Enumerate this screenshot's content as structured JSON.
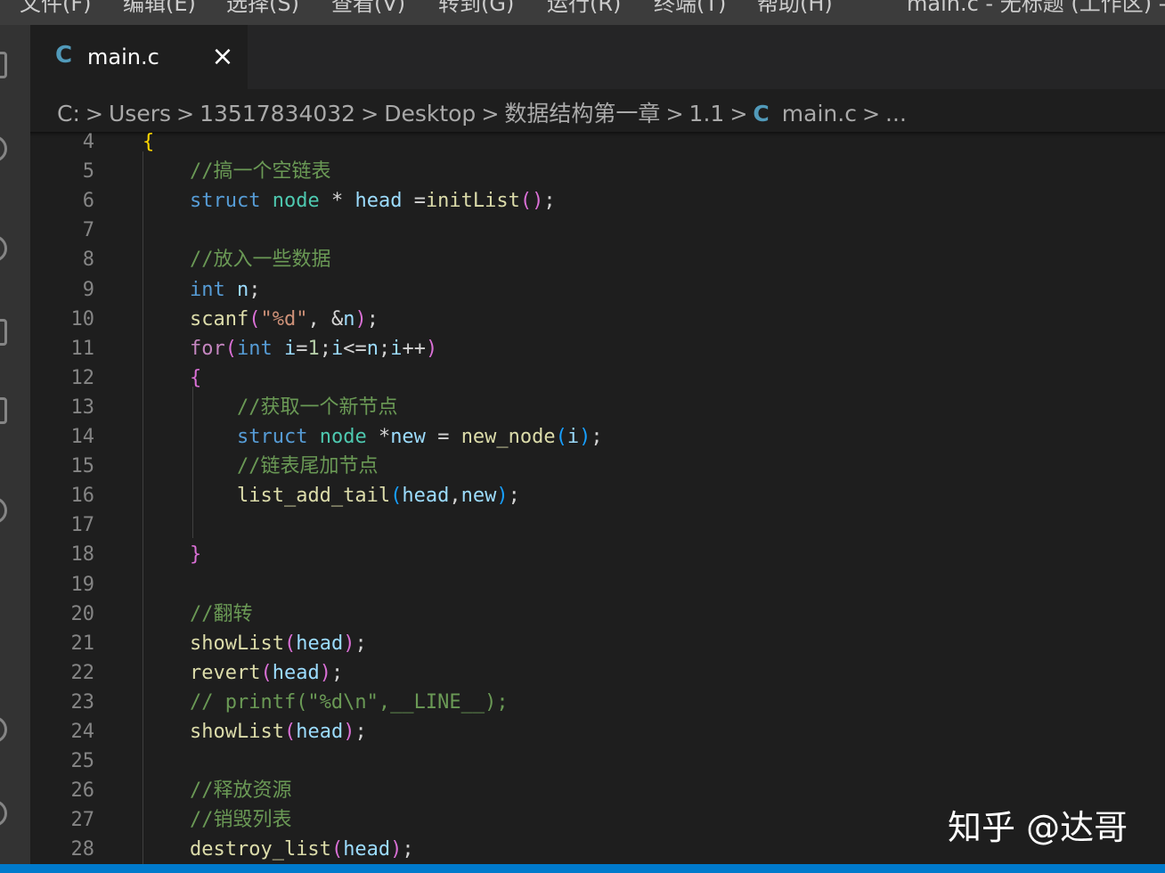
{
  "menubar": {
    "items": [
      "文件(F)",
      "编辑(E)",
      "选择(S)",
      "查看(V)",
      "转到(G)",
      "运行(R)",
      "终端(T)",
      "帮助(H)"
    ],
    "title": "main.c - 无标题 (工作区) -"
  },
  "tab": {
    "icon": "C",
    "label": "main.c",
    "close": "×"
  },
  "breadcrumbs": {
    "items": [
      "C:",
      "Users",
      "13517834032",
      "Desktop",
      "数据结构第一章",
      "1.1",
      "main.c",
      "..."
    ],
    "separator": ">",
    "file_icon": "C"
  },
  "editor": {
    "lines": [
      {
        "n": "4",
        "code": "{"
      },
      {
        "n": "5",
        "code": "    //搞一个空链表"
      },
      {
        "n": "6",
        "code": "    struct node * head =initList();"
      },
      {
        "n": "7",
        "code": ""
      },
      {
        "n": "8",
        "code": "    //放入一些数据"
      },
      {
        "n": "9",
        "code": "    int n;"
      },
      {
        "n": "10",
        "code": "    scanf(\"%d\", &n);"
      },
      {
        "n": "11",
        "code": "    for(int i=1;i<=n;i++)"
      },
      {
        "n": "12",
        "code": "    {"
      },
      {
        "n": "13",
        "code": "        //获取一个新节点"
      },
      {
        "n": "14",
        "code": "        struct node *new = new_node(i);"
      },
      {
        "n": "15",
        "code": "        //链表尾加节点"
      },
      {
        "n": "16",
        "code": "        list_add_tail(head,new);"
      },
      {
        "n": "17",
        "code": ""
      },
      {
        "n": "18",
        "code": "    }"
      },
      {
        "n": "19",
        "code": ""
      },
      {
        "n": "20",
        "code": "    //翻转"
      },
      {
        "n": "21",
        "code": "    showList(head);"
      },
      {
        "n": "22",
        "code": "    revert(head);"
      },
      {
        "n": "23",
        "code": "    // printf(\"%d\\n\",__LINE__);"
      },
      {
        "n": "24",
        "code": "    showList(head);"
      },
      {
        "n": "25",
        "code": ""
      },
      {
        "n": "26",
        "code": "    //释放资源"
      },
      {
        "n": "27",
        "code": "    //销毁列表"
      },
      {
        "n": "28",
        "code": "    destroy_list(head);"
      }
    ]
  },
  "watermark": "知乎 @达哥",
  "theme": {
    "keyword": "#569cd6",
    "control": "#c586c0",
    "type": "#4ec9b0",
    "variable": "#9cdcfe",
    "function": "#dcdcaa",
    "string": "#ce9178",
    "number": "#b5cea8",
    "comment": "#6a9955",
    "status_bar": "#007acc"
  }
}
